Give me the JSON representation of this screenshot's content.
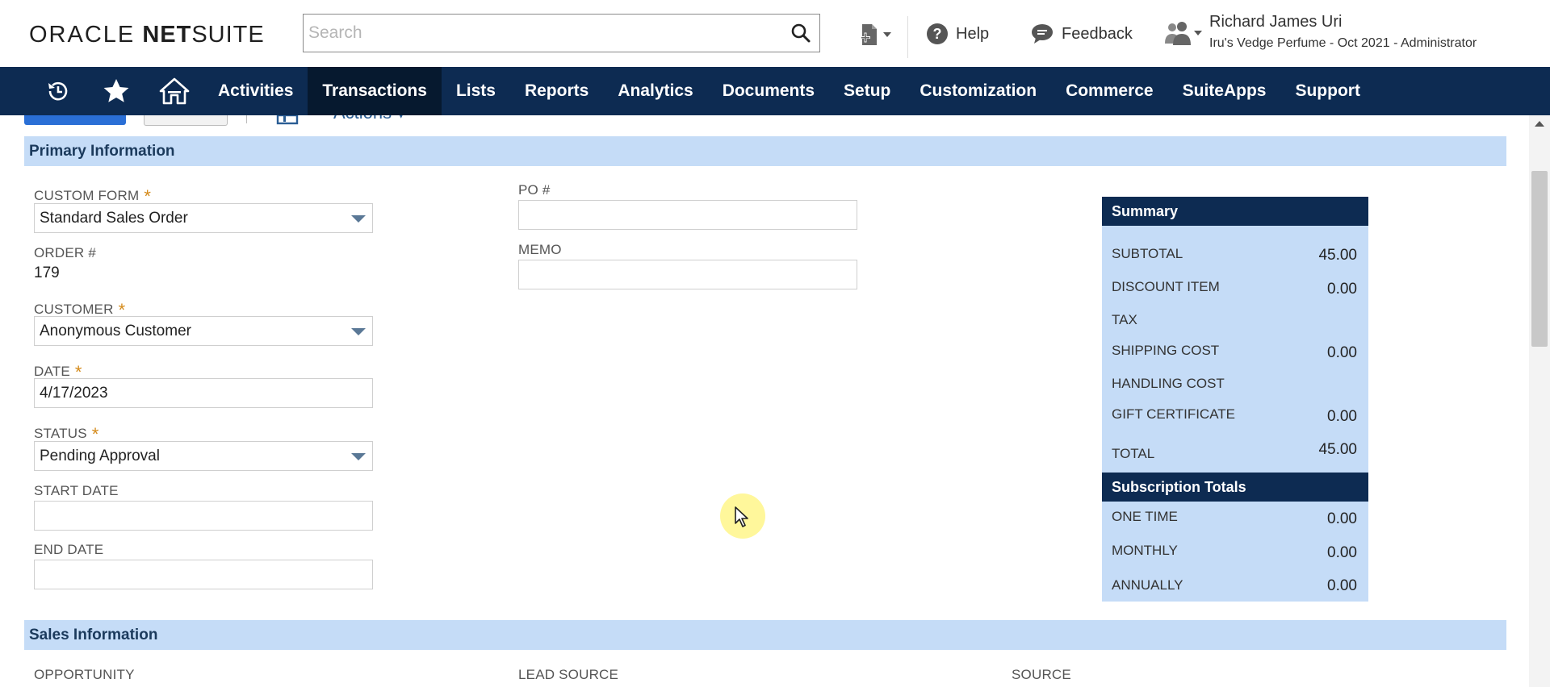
{
  "header": {
    "logo_oracle": "ORACLE",
    "logo_net": "NET",
    "logo_suite": "SUITE",
    "search_placeholder": "Search",
    "help_label": "Help",
    "feedback_label": "Feedback",
    "user_name": "Richard James Uri",
    "user_role": "Iru's Vedge Perfume - Oct 2021 - Administrator"
  },
  "nav": {
    "items": [
      {
        "label": "Activities"
      },
      {
        "label": "Transactions",
        "active": true
      },
      {
        "label": "Lists"
      },
      {
        "label": "Reports"
      },
      {
        "label": "Analytics"
      },
      {
        "label": "Documents"
      },
      {
        "label": "Setup"
      },
      {
        "label": "Customization"
      },
      {
        "label": "Commerce"
      },
      {
        "label": "SuiteApps"
      },
      {
        "label": "Support"
      }
    ]
  },
  "toolbar": {
    "actions_label": "Actions ▾"
  },
  "primary": {
    "title": "Primary Information",
    "custom_form_label": "CUSTOM FORM",
    "custom_form_value": "Standard Sales Order",
    "order_label": "ORDER #",
    "order_value": "179",
    "customer_label": "CUSTOMER",
    "customer_value": "Anonymous Customer",
    "date_label": "DATE",
    "date_value": "4/17/2023",
    "status_label": "STATUS",
    "status_value": "Pending Approval",
    "start_date_label": "START DATE",
    "start_date_value": "",
    "end_date_label": "END DATE",
    "end_date_value": "",
    "po_label": "PO #",
    "po_value": "",
    "memo_label": "MEMO",
    "memo_value": "",
    "required_mark": "*"
  },
  "summary": {
    "title": "Summary",
    "subtotal_label": "SUBTOTAL",
    "subtotal_value": "45.00",
    "discount_label": "DISCOUNT ITEM",
    "discount_value": "0.00",
    "tax_label": "TAX",
    "tax_value": "",
    "shipping_label": "SHIPPING COST",
    "shipping_value": "0.00",
    "handling_label": "HANDLING COST",
    "handling_value": "",
    "gift_label": "GIFT CERTIFICATE",
    "gift_value": "0.00",
    "total_label": "TOTAL",
    "total_value": "45.00",
    "subs_title": "Subscription Totals",
    "one_time_label": "ONE TIME",
    "one_time_value": "0.00",
    "monthly_label": "MONTHLY",
    "monthly_value": "0.00",
    "annually_label": "ANNUALLY",
    "annually_value": "0.00"
  },
  "sales": {
    "title": "Sales Information",
    "opportunity_label": "OPPORTUNITY",
    "lead_source_label": "LEAD SOURCE",
    "source_label": "SOURCE"
  },
  "colors": {
    "nav_bg": "#0d2b52",
    "nav_active": "#06192f",
    "section_bg": "#c5dcf7",
    "required": "#d48a1a"
  }
}
